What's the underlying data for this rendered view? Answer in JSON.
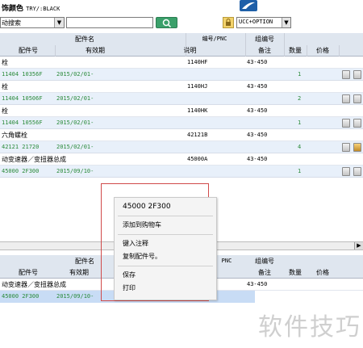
{
  "header": {
    "color_label": "饰颜色",
    "color_value": "TRY/:BLACK"
  },
  "search": {
    "mode_value": "动搜索",
    "query_value": "",
    "option_value": "UCC+OPTION"
  },
  "table": {
    "group_header_1": "配件名",
    "group_header_2": "编号/PNC",
    "group_header_3": "组编号",
    "col_part_no": "配件号",
    "col_validity": "有效期",
    "col_desc": "说明",
    "col_remark": "备注",
    "col_qty": "数量",
    "col_price": "价格"
  },
  "rows": [
    {
      "name": "栓",
      "pnc": "1140HF",
      "group": "43-450",
      "part_no": "11404 10356F",
      "validity": "2015/02/01-",
      "qty": "1"
    },
    {
      "name": "栓",
      "pnc": "1140HJ",
      "group": "43-450",
      "part_no": "11404 10506F",
      "validity": "2015/02/01-",
      "qty": "2"
    },
    {
      "name": "栓",
      "pnc": "1140HK",
      "group": "43-450",
      "part_no": "11404 10556F",
      "validity": "2015/02/01-",
      "qty": "1"
    },
    {
      "name": "六角螺栓",
      "pnc": "42121B",
      "group": "43-450",
      "part_no": "42121 21720",
      "validity": "2015/02/01-",
      "qty": "4"
    },
    {
      "name": "动变速器／变扭器总成",
      "pnc": "45000A",
      "group": "43-450",
      "part_no": "45000 2F300",
      "validity": "2015/09/10-",
      "qty": "1"
    }
  ],
  "lower_table": {
    "group_header_1": "配件名",
    "group_header_2": "PNC",
    "group_header_3": "组编号",
    "col_part_no": "配件号",
    "col_validity": "有效期",
    "col_remark": "备注",
    "col_qty": "数量",
    "col_price": "价格",
    "row_name": "动变速器／变扭器总成",
    "row_group": "43-450",
    "row_part_no": "45000 2F300",
    "row_validity": "2015/09/10-"
  },
  "context_menu": {
    "part_number": "45000 2F300",
    "add_to_cart": "添加到购物车",
    "add_note": "键入注释",
    "copy_part_no": "复制配件号。",
    "save": "保存",
    "print": "打印"
  },
  "watermark": "软件技巧",
  "colors": {
    "header_bg": "#dfe6ef",
    "data_row_bg": "#e8f0fa",
    "green_text": "#2a8a3a",
    "menu_border": "#d04a4a",
    "search_button": "#3aa06a"
  }
}
